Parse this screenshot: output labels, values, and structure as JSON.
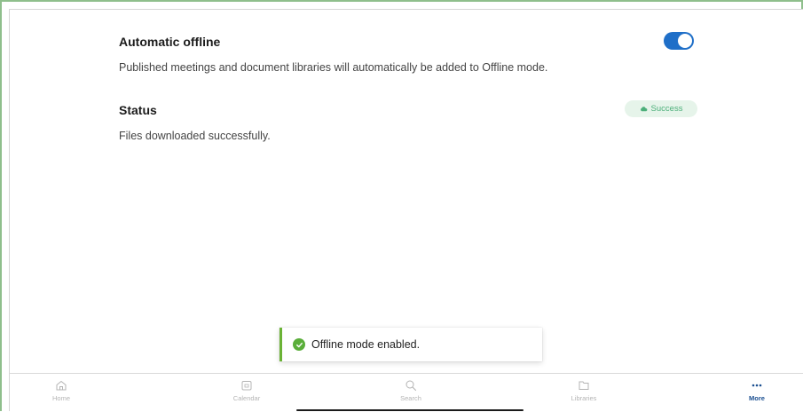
{
  "automatic_offline": {
    "title": "Automatic offline",
    "description": "Published meetings and document libraries will automatically be added to Offline mode.",
    "toggle_on": true
  },
  "status": {
    "title": "Status",
    "description": "Files downloaded successfully.",
    "badge": "Success"
  },
  "toast": {
    "message": "Offline mode enabled."
  },
  "tabbar": {
    "home": "Home",
    "calendar": "Calendar",
    "search": "Search",
    "libraries": "Libraries",
    "more": "More"
  },
  "colors": {
    "accent": "#1f6fc8",
    "success": "#5aae3a",
    "active_tab": "#1b4f91"
  },
  "icons": {
    "home": "home-icon",
    "calendar": "calendar-icon",
    "search": "search-icon",
    "libraries": "folder-icon",
    "more": "more-dots-icon",
    "badge": "cloud-icon",
    "toast": "check-circle-icon"
  }
}
